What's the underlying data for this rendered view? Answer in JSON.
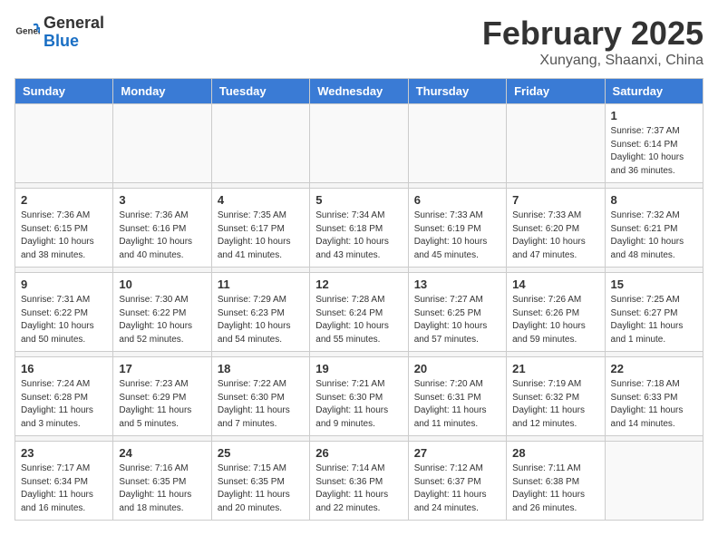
{
  "header": {
    "logo_text_general": "General",
    "logo_text_blue": "Blue",
    "month_title": "February 2025",
    "location": "Xunyang, Shaanxi, China"
  },
  "weekdays": [
    "Sunday",
    "Monday",
    "Tuesday",
    "Wednesday",
    "Thursday",
    "Friday",
    "Saturday"
  ],
  "weeks": [
    [
      {
        "day": "",
        "info": ""
      },
      {
        "day": "",
        "info": ""
      },
      {
        "day": "",
        "info": ""
      },
      {
        "day": "",
        "info": ""
      },
      {
        "day": "",
        "info": ""
      },
      {
        "day": "",
        "info": ""
      },
      {
        "day": "1",
        "info": "Sunrise: 7:37 AM\nSunset: 6:14 PM\nDaylight: 10 hours\nand 36 minutes."
      }
    ],
    [
      {
        "day": "2",
        "info": "Sunrise: 7:36 AM\nSunset: 6:15 PM\nDaylight: 10 hours\nand 38 minutes."
      },
      {
        "day": "3",
        "info": "Sunrise: 7:36 AM\nSunset: 6:16 PM\nDaylight: 10 hours\nand 40 minutes."
      },
      {
        "day": "4",
        "info": "Sunrise: 7:35 AM\nSunset: 6:17 PM\nDaylight: 10 hours\nand 41 minutes."
      },
      {
        "day": "5",
        "info": "Sunrise: 7:34 AM\nSunset: 6:18 PM\nDaylight: 10 hours\nand 43 minutes."
      },
      {
        "day": "6",
        "info": "Sunrise: 7:33 AM\nSunset: 6:19 PM\nDaylight: 10 hours\nand 45 minutes."
      },
      {
        "day": "7",
        "info": "Sunrise: 7:33 AM\nSunset: 6:20 PM\nDaylight: 10 hours\nand 47 minutes."
      },
      {
        "day": "8",
        "info": "Sunrise: 7:32 AM\nSunset: 6:21 PM\nDaylight: 10 hours\nand 48 minutes."
      }
    ],
    [
      {
        "day": "9",
        "info": "Sunrise: 7:31 AM\nSunset: 6:22 PM\nDaylight: 10 hours\nand 50 minutes."
      },
      {
        "day": "10",
        "info": "Sunrise: 7:30 AM\nSunset: 6:22 PM\nDaylight: 10 hours\nand 52 minutes."
      },
      {
        "day": "11",
        "info": "Sunrise: 7:29 AM\nSunset: 6:23 PM\nDaylight: 10 hours\nand 54 minutes."
      },
      {
        "day": "12",
        "info": "Sunrise: 7:28 AM\nSunset: 6:24 PM\nDaylight: 10 hours\nand 55 minutes."
      },
      {
        "day": "13",
        "info": "Sunrise: 7:27 AM\nSunset: 6:25 PM\nDaylight: 10 hours\nand 57 minutes."
      },
      {
        "day": "14",
        "info": "Sunrise: 7:26 AM\nSunset: 6:26 PM\nDaylight: 10 hours\nand 59 minutes."
      },
      {
        "day": "15",
        "info": "Sunrise: 7:25 AM\nSunset: 6:27 PM\nDaylight: 11 hours\nand 1 minute."
      }
    ],
    [
      {
        "day": "16",
        "info": "Sunrise: 7:24 AM\nSunset: 6:28 PM\nDaylight: 11 hours\nand 3 minutes."
      },
      {
        "day": "17",
        "info": "Sunrise: 7:23 AM\nSunset: 6:29 PM\nDaylight: 11 hours\nand 5 minutes."
      },
      {
        "day": "18",
        "info": "Sunrise: 7:22 AM\nSunset: 6:30 PM\nDaylight: 11 hours\nand 7 minutes."
      },
      {
        "day": "19",
        "info": "Sunrise: 7:21 AM\nSunset: 6:30 PM\nDaylight: 11 hours\nand 9 minutes."
      },
      {
        "day": "20",
        "info": "Sunrise: 7:20 AM\nSunset: 6:31 PM\nDaylight: 11 hours\nand 11 minutes."
      },
      {
        "day": "21",
        "info": "Sunrise: 7:19 AM\nSunset: 6:32 PM\nDaylight: 11 hours\nand 12 minutes."
      },
      {
        "day": "22",
        "info": "Sunrise: 7:18 AM\nSunset: 6:33 PM\nDaylight: 11 hours\nand 14 minutes."
      }
    ],
    [
      {
        "day": "23",
        "info": "Sunrise: 7:17 AM\nSunset: 6:34 PM\nDaylight: 11 hours\nand 16 minutes."
      },
      {
        "day": "24",
        "info": "Sunrise: 7:16 AM\nSunset: 6:35 PM\nDaylight: 11 hours\nand 18 minutes."
      },
      {
        "day": "25",
        "info": "Sunrise: 7:15 AM\nSunset: 6:35 PM\nDaylight: 11 hours\nand 20 minutes."
      },
      {
        "day": "26",
        "info": "Sunrise: 7:14 AM\nSunset: 6:36 PM\nDaylight: 11 hours\nand 22 minutes."
      },
      {
        "day": "27",
        "info": "Sunrise: 7:12 AM\nSunset: 6:37 PM\nDaylight: 11 hours\nand 24 minutes."
      },
      {
        "day": "28",
        "info": "Sunrise: 7:11 AM\nSunset: 6:38 PM\nDaylight: 11 hours\nand 26 minutes."
      },
      {
        "day": "",
        "info": ""
      }
    ]
  ]
}
